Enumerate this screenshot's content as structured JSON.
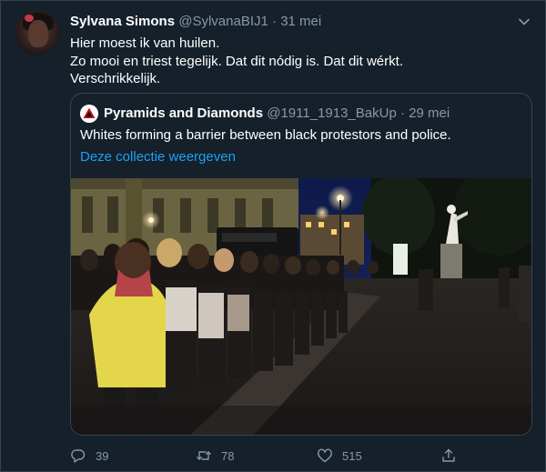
{
  "tweet": {
    "author_name": "Sylvana Simons",
    "handle": "@SylvanaBIJ1",
    "separator": "·",
    "date": "31 mei",
    "text_lines": [
      "Hier moest ik van huilen.",
      "Zo mooi en triest tegelijk. Dat dit nódig is. Dat dit wérkt.",
      "Verschrikkelijk."
    ]
  },
  "quoted": {
    "author_name": "Pyramids and Diamonds",
    "handle": "@1911_1913_BakUp",
    "separator": "·",
    "date": "29 mei",
    "text": "Whites forming a barrier between black protestors and police.",
    "collection_link": "Deze collectie weergeven",
    "photo_icon": "night-protest-photo"
  },
  "actions": {
    "reply_count": "39",
    "retweet_count": "78",
    "like_count": "515"
  },
  "colors": {
    "background": "#15202b",
    "border": "#38444d",
    "secondary_text": "#8899a6",
    "link": "#1da1f2"
  }
}
